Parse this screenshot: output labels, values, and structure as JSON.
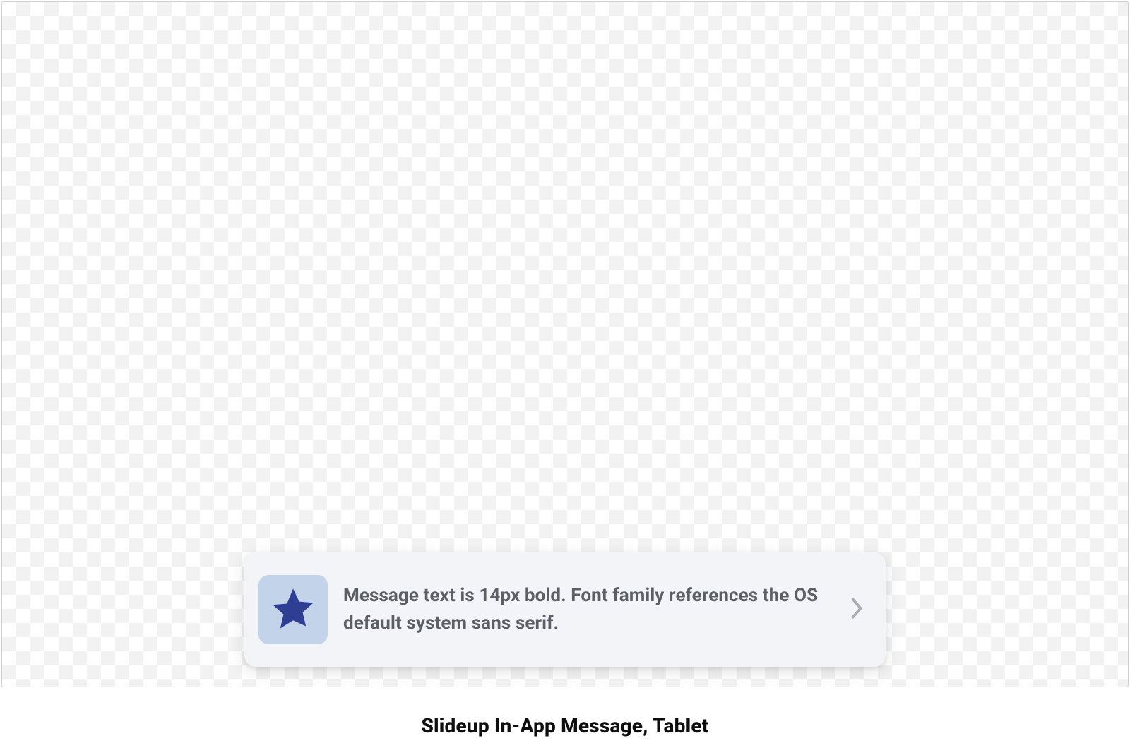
{
  "message": {
    "icon_name": "star-icon",
    "icon_tile_bg": "#c3d3ea",
    "icon_fill": "#2e3e93",
    "text": "Message text is 14px bold. Font family references the OS default system sans serif.",
    "chevron_name": "chevron-right-icon"
  },
  "caption": "Slideup In-App Message, Tablet"
}
